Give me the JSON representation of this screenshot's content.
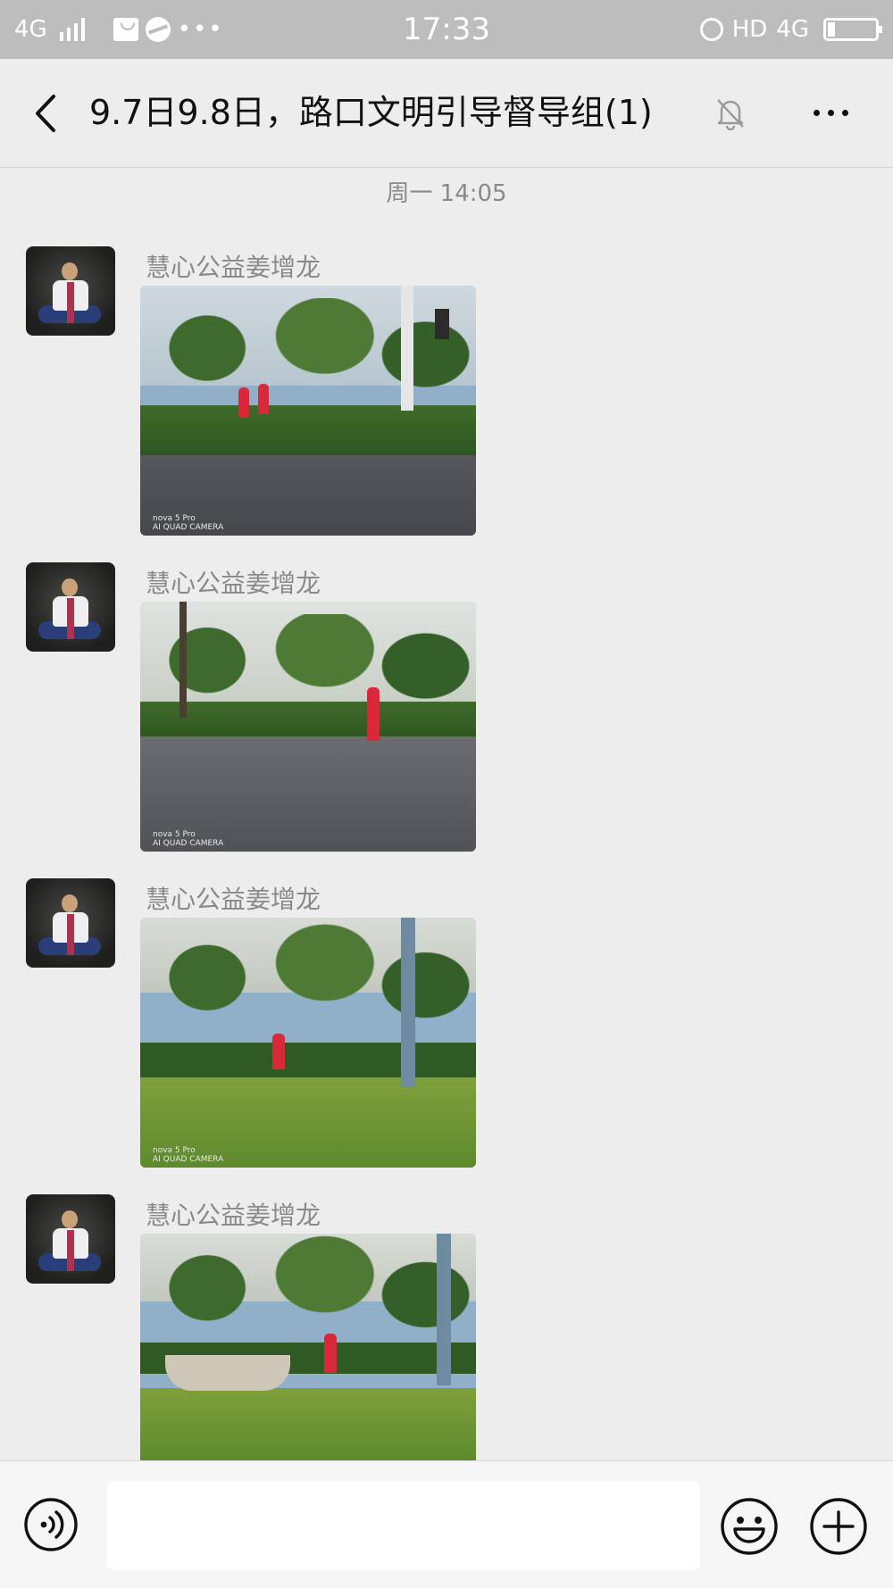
{
  "status_bar": {
    "network_left": "4G",
    "time": "17:33",
    "hd_label": "HD",
    "network_right": "4G"
  },
  "header": {
    "title": "9.7日9.8日，路口文明引导督导组(1)"
  },
  "chat": {
    "timestamp": "周一 14:05",
    "messages": [
      {
        "sender": "慧心公益姜增龙",
        "watermark_line1": "nova 5 Pro",
        "watermark_line2": "AI QUAD CAMERA"
      },
      {
        "sender": "慧心公益姜增龙",
        "watermark_line1": "nova 5 Pro",
        "watermark_line2": "AI QUAD CAMERA"
      },
      {
        "sender": "慧心公益姜增龙",
        "watermark_line1": "nova 5 Pro",
        "watermark_line2": "AI QUAD CAMERA"
      },
      {
        "sender": "慧心公益姜增龙"
      }
    ]
  },
  "input_bar": {
    "placeholder": ""
  },
  "icons": {
    "back": "chevron-left-icon",
    "mute": "bell-off-icon",
    "more": "more-horizontal-icon",
    "voice": "voice-icon",
    "emoji": "emoji-icon",
    "plus": "plus-icon"
  },
  "colors": {
    "status_bar_bg": "#bdbdbd",
    "chat_bg": "#ededed",
    "sender_text": "#8a8a8a",
    "input_bar_bg": "#f6f6f6"
  }
}
